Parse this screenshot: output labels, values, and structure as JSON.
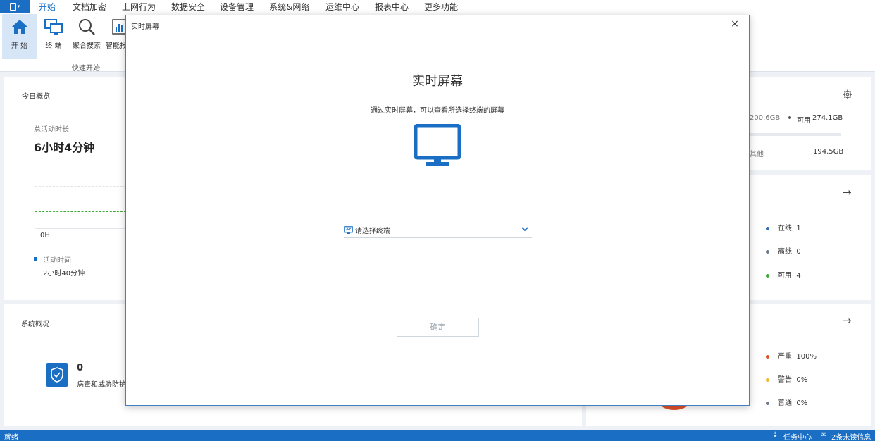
{
  "menubar": {
    "items": [
      "开始",
      "文档加密",
      "上网行为",
      "数据安全",
      "设备管理",
      "系统&网络",
      "运维中心",
      "报表中心",
      "更多功能"
    ]
  },
  "ribbon": {
    "buttons": [
      "开 始",
      "终 端",
      "聚合搜索",
      "智能报"
    ],
    "group_label": "快速开始"
  },
  "today": {
    "title": "今日概览",
    "total_label": "总活动时长",
    "total_value": "6小时4分钟",
    "axis_label": "0H",
    "legend_label": "活动时间",
    "legend_value": "2小时40分钟"
  },
  "system": {
    "title": "系统概况",
    "count": "0",
    "label": "病毒和威胁防护"
  },
  "storage": {
    "used_partial": "200.6GB",
    "available_label": "可用",
    "available_value": "274.1GB",
    "other_label": "其他",
    "other_value": "194.5GB"
  },
  "terminals": {
    "items": [
      {
        "label": "在线",
        "value": "1",
        "color": "#2f6eb5"
      },
      {
        "label": "离线",
        "value": "0",
        "color": "#6b7a8c"
      },
      {
        "label": "可用",
        "value": "4",
        "color": "#3aaa35"
      }
    ]
  },
  "alerts": {
    "items": [
      {
        "label": "严重",
        "value": "100%",
        "color": "#e0522a"
      },
      {
        "label": "警告",
        "value": "0%",
        "color": "#f2b824"
      },
      {
        "label": "普通",
        "value": "0%",
        "color": "#6b7a8c"
      }
    ]
  },
  "status": {
    "left": "就绪",
    "task_center": "任务中心",
    "messages": "2条未读信息"
  },
  "dialog": {
    "title": "实时屏幕",
    "heading": "实时屏幕",
    "description": "通过实时屏幕，可以查看所选择终端的屏幕",
    "select_placeholder": "请选择终端",
    "confirm": "确定",
    "close": "×"
  },
  "colors": {
    "accent": "#1a6fc4"
  }
}
